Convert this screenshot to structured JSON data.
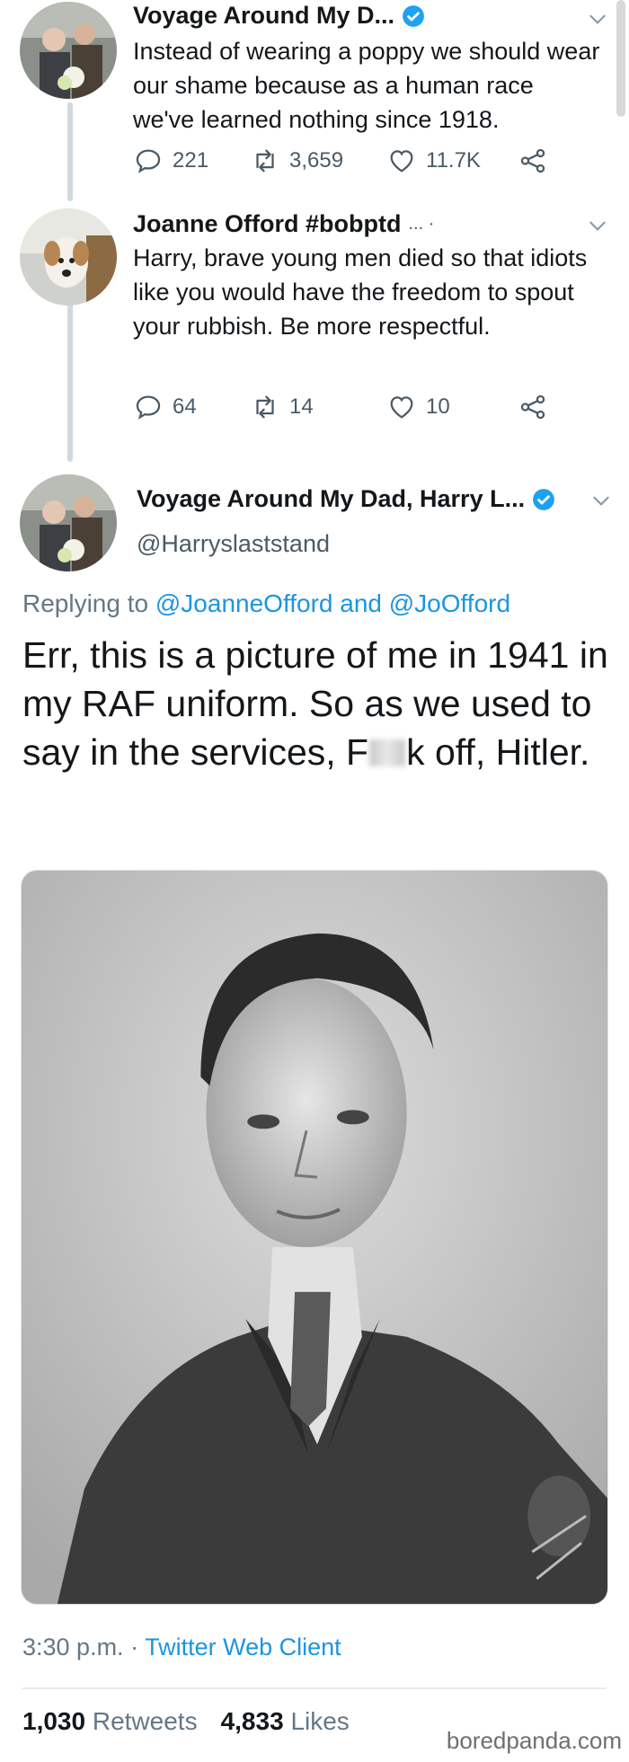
{
  "tweets": [
    {
      "display_name": "Voyage Around My D...",
      "verified": true,
      "text": "Instead of wearing a poppy we should wear our shame because as a human race we've learned nothing since 1918.",
      "replies": "221",
      "retweets": "3,659",
      "likes": "11.7K"
    },
    {
      "display_name": "Joanne Offord #bobptd",
      "name_suffix": "... ·",
      "verified": false,
      "text": "Harry, brave young men died so that idiots like you would have the freedom to spout your rubbish.  Be more respectful.",
      "replies": "64",
      "retweets": "14",
      "likes": "10"
    }
  ],
  "main_tweet": {
    "display_name": "Voyage Around My Dad, Harry L...",
    "verified": true,
    "handle": "@Harryslaststand",
    "replying_prefix": "Replying to",
    "reply_mention_1": "@JoanneOfford",
    "reply_and": "and",
    "reply_mention_2": "@JoOfford",
    "text_part1": "Err, this is a picture of me in 1941 in my RAF uniform.  So as we used to say in the services, F",
    "text_part2": "k off, Hitler.",
    "time": "3:30 p.m.",
    "separator": "·",
    "client": "Twitter Web Client",
    "retweets_count": "1,030",
    "retweets_label": "Retweets",
    "likes_count": "4,833",
    "likes_label": "Likes"
  },
  "watermark": "boredpanda.com",
  "icons": {
    "reply": "reply-icon",
    "retweet": "retweet-icon",
    "like": "heart-icon",
    "share": "share-icon",
    "verified": "verified-badge-icon",
    "menu": "chevron-down-icon"
  },
  "colors": {
    "accent": "#1b95e0",
    "verified": "#1da1f2",
    "muted": "#657786",
    "text": "#14171a"
  }
}
